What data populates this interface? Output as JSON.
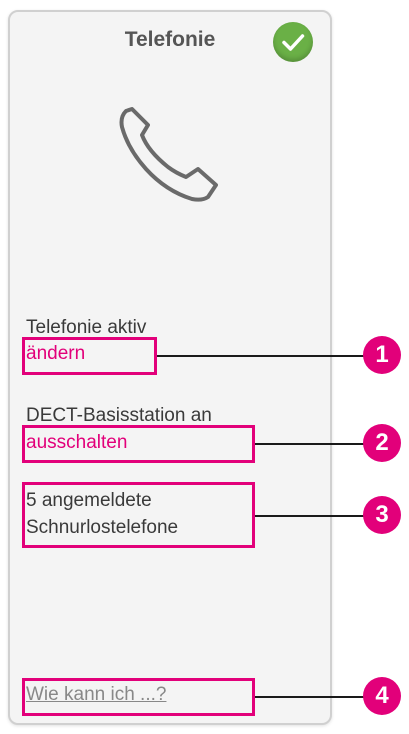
{
  "tile": {
    "title": "Telefonie",
    "status_icon": "check-icon",
    "main_icon": "phone-icon",
    "phone_status": "Telefonie aktiv",
    "phone_link": "ändern",
    "dect_status": "DECT-Basisstation an",
    "dect_link": "ausschalten",
    "handsets_line1": "5 angemeldete",
    "handsets_line2": "Schnurlostelefone",
    "help_link": "Wie kann ich ...?"
  },
  "callouts": [
    "1",
    "2",
    "3",
    "4"
  ],
  "colors": {
    "accent": "#e2007a",
    "status_ok": "#6ab046",
    "text": "#3a3a3a",
    "card_bg": "#f4f4f4"
  }
}
